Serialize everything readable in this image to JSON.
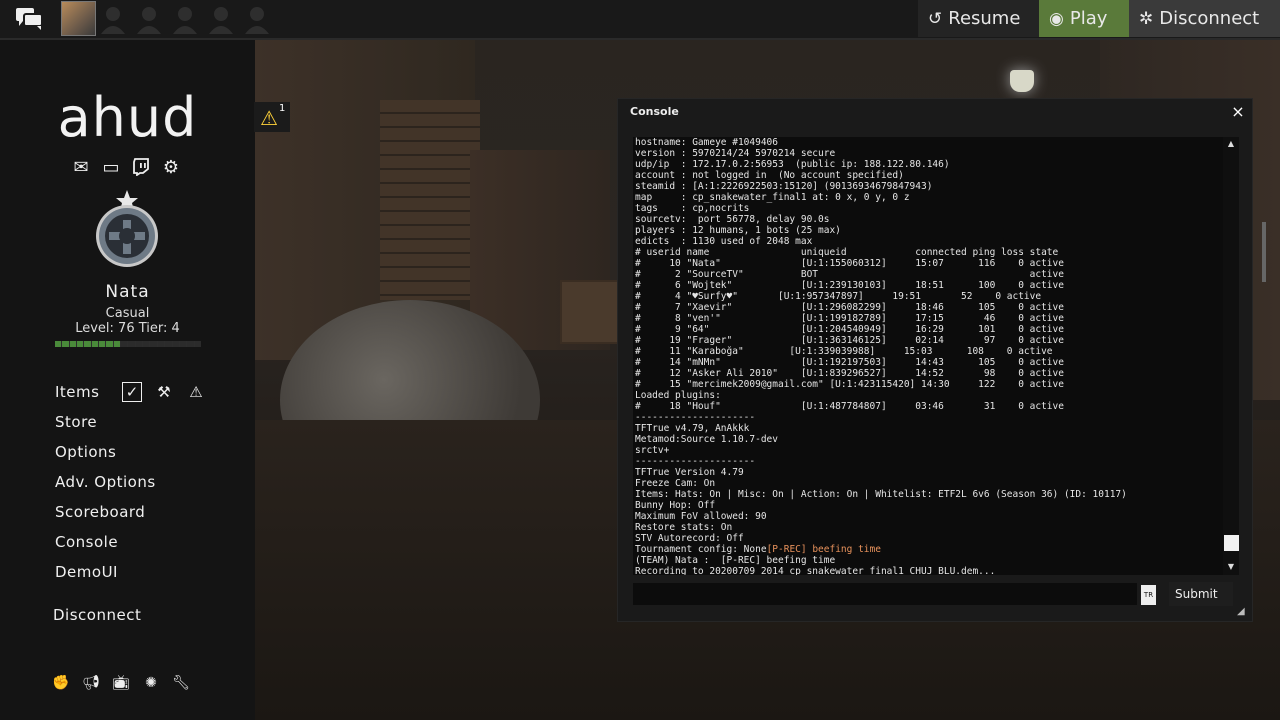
{
  "topbar": {
    "resume_label": "Resume",
    "play_label": "Play",
    "disconnect_label": "Disconnect"
  },
  "sidebar": {
    "logo": "ahud",
    "player_name": "Nata",
    "mode": "Casual",
    "level": "Level: 76 Tier: 4",
    "menu": [
      "Items",
      "Store",
      "Options",
      "Adv. Options",
      "Scoreboard",
      "Console",
      "DemoUI"
    ],
    "disconnect_label": "Disconnect"
  },
  "warning": {
    "count": "1"
  },
  "console": {
    "title": "Console",
    "close": "×",
    "lines": [
      "hostname: Gameye #1049406",
      "version : 5970214/24 5970214 secure",
      "udp/ip  : 172.17.0.2:56953  (public ip: 188.122.80.146)",
      "account : not logged in  (No account specified)",
      "steamid : [A:1:2226922503:15120] (90136934679847943)",
      "map     : cp_snakewater_final1 at: 0 x, 0 y, 0 z",
      "tags    : cp,nocrits",
      "sourcetv:  port 56778, delay 90.0s",
      "players : 12 humans, 1 bots (25 max)",
      "edicts  : 1130 used of 2048 max",
      "# userid name                uniqueid            connected ping loss state",
      "#     10 \"Nata\"              [U:1:155060312]     15:07      116    0 active",
      "#      2 \"SourceTV\"          BOT                                     active",
      "#      6 \"Wojtek\"            [U:1:239130103]     18:51      100    0 active",
      "#      4 \"♥Surfy♥\"       [U:1:957347897]     19:51       52    0 active",
      "#      7 \"Xaevir\"            [U:1:296082299]     18:46      105    0 active",
      "#      8 \"ven'\"              [U:1:199182789]     17:15       46    0 active",
      "#      9 \"64\"                [U:1:204540949]     16:29      101    0 active",
      "#     19 \"Frager\"            [U:1:363146125]     02:14       97    0 active",
      "#     11 \"Karaboğa\"        [U:1:339039988]     15:03      108    0 active",
      "#     14 \"mNMn\"              [U:1:192197503]     14:43      105    0 active",
      "#     12 \"Asker Ali 2010\"    [U:1:839296527]     14:52       98    0 active",
      "#     15 \"mercimek2009@gmail.com\" [U:1:423115420] 14:30     122    0 active",
      "Loaded plugins:",
      "#     18 \"Houf\"              [U:1:487784807]     03:46       31    0 active",
      "---------------------",
      "TFTrue v4.79, AnAkkk",
      "Metamod:Source 1.10.7-dev",
      "srctv+",
      "---------------------",
      "TFTrue Version 4.79",
      "Freeze Cam: On",
      "Items: Hats: On | Misc: On | Action: On | Whitelist: ETF2L 6v6 (Season 36) (ID: 10117)",
      "Bunny Hop: Off",
      "Maximum FoV allowed: 90",
      "Restore stats: On",
      "STV Autorecord: Off"
    ],
    "line_tournament": "Tournament config: None",
    "line_tournament_hl": "[P-REC] beefing time",
    "line_team": "(TEAM) Nata :  [P-REC] beefing time",
    "line_recording": "Recording to 20200709 2014 cp snakewater final1 CHUJ BLU.dem...",
    "input_value": "",
    "lang_badge": "TR",
    "submit_label": "Submit"
  },
  "icons": {
    "chat": "chat-icon",
    "mail": "mail-icon",
    "window": "window-icon",
    "twitch": "twitch-icon",
    "gear": "gear-icon",
    "check": "checkbox-icon",
    "craft": "craft-icon",
    "warning": "warning-icon"
  },
  "colors": {
    "play_green": "#5a7a3a",
    "warn_yellow": "#ffd23a",
    "console_highlight": "#e8925c",
    "xp_green": "#4a8a3a"
  },
  "xp_progress": 0.45
}
